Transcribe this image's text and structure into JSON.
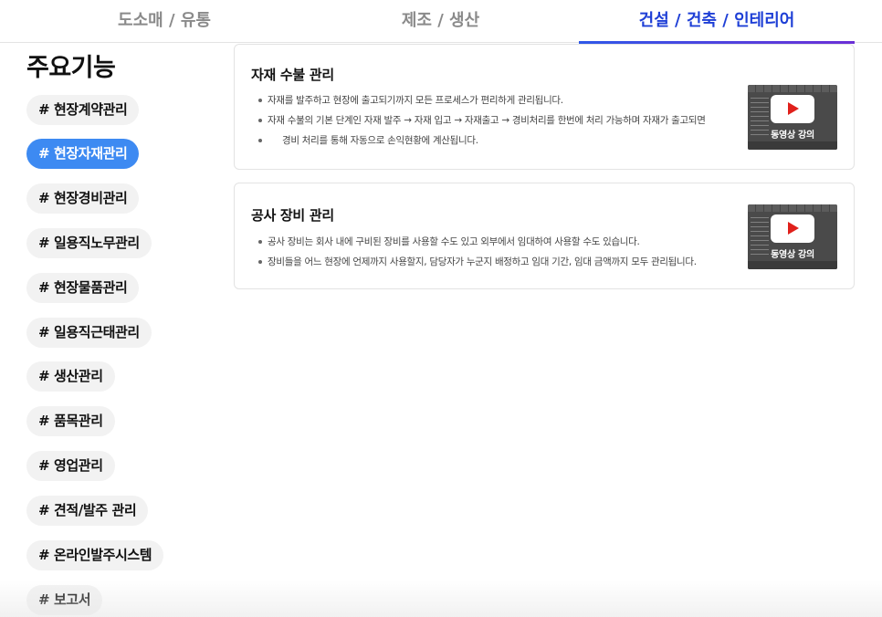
{
  "tabs": [
    {
      "label": "도소매 / 유통",
      "active": false
    },
    {
      "label": "제조 / 생산",
      "active": false
    },
    {
      "label": "건설 / 건축 / 인테리어",
      "active": true
    }
  ],
  "colors": {
    "accent": "#1e3fd6",
    "active_chip": "#3d8af2",
    "play_red": "#e0201b"
  },
  "sidebar": {
    "heading": "주요기능",
    "items": [
      {
        "label": "# 현장계약관리",
        "active": false
      },
      {
        "label": "# 현장자재관리",
        "active": true
      },
      {
        "label": "# 현장경비관리",
        "active": false
      },
      {
        "label": "# 일용직노무관리",
        "active": false
      },
      {
        "label": "# 현장물품관리",
        "active": false
      },
      {
        "label": "# 일용직근태관리",
        "active": false
      },
      {
        "label": "# 생산관리",
        "active": false
      },
      {
        "label": "# 품목관리",
        "active": false
      },
      {
        "label": "# 영업관리",
        "active": false
      },
      {
        "label": "# 견적/발주 관리",
        "active": false
      },
      {
        "label": "# 온라인발주시스템",
        "active": false
      },
      {
        "label": "# 보고서",
        "active": false
      }
    ]
  },
  "cards": [
    {
      "title": "자재 수불 관리",
      "bullets": [
        "자재를 발주하고 현장에 출고되기까지 모든 프로세스가 편리하게 관리됩니다.",
        "자재 수불의 기본 단계인 자재 발주 → 자재 입고 → 자재출고 → 경비처리를 한번에 처리 가능하며 자재가 출고되면",
        "경비 처리를 통해 자동으로 손익현황에 계산됩니다."
      ],
      "video_label": "동영상 강의",
      "video_icon": "play-icon"
    },
    {
      "title": "공사 장비 관리",
      "bullets": [
        "공사 장비는 회사 내에 구비된 장비를 사용할 수도 있고 외부에서 임대하여 사용할 수도 있습니다.",
        "장비들을 어느 현장에 언제까지 사용할지, 담당자가 누군지 배정하고 임대 기간, 임대 금액까지 모두 관리됩니다."
      ],
      "video_label": "동영상 강의",
      "video_icon": "play-icon"
    }
  ]
}
